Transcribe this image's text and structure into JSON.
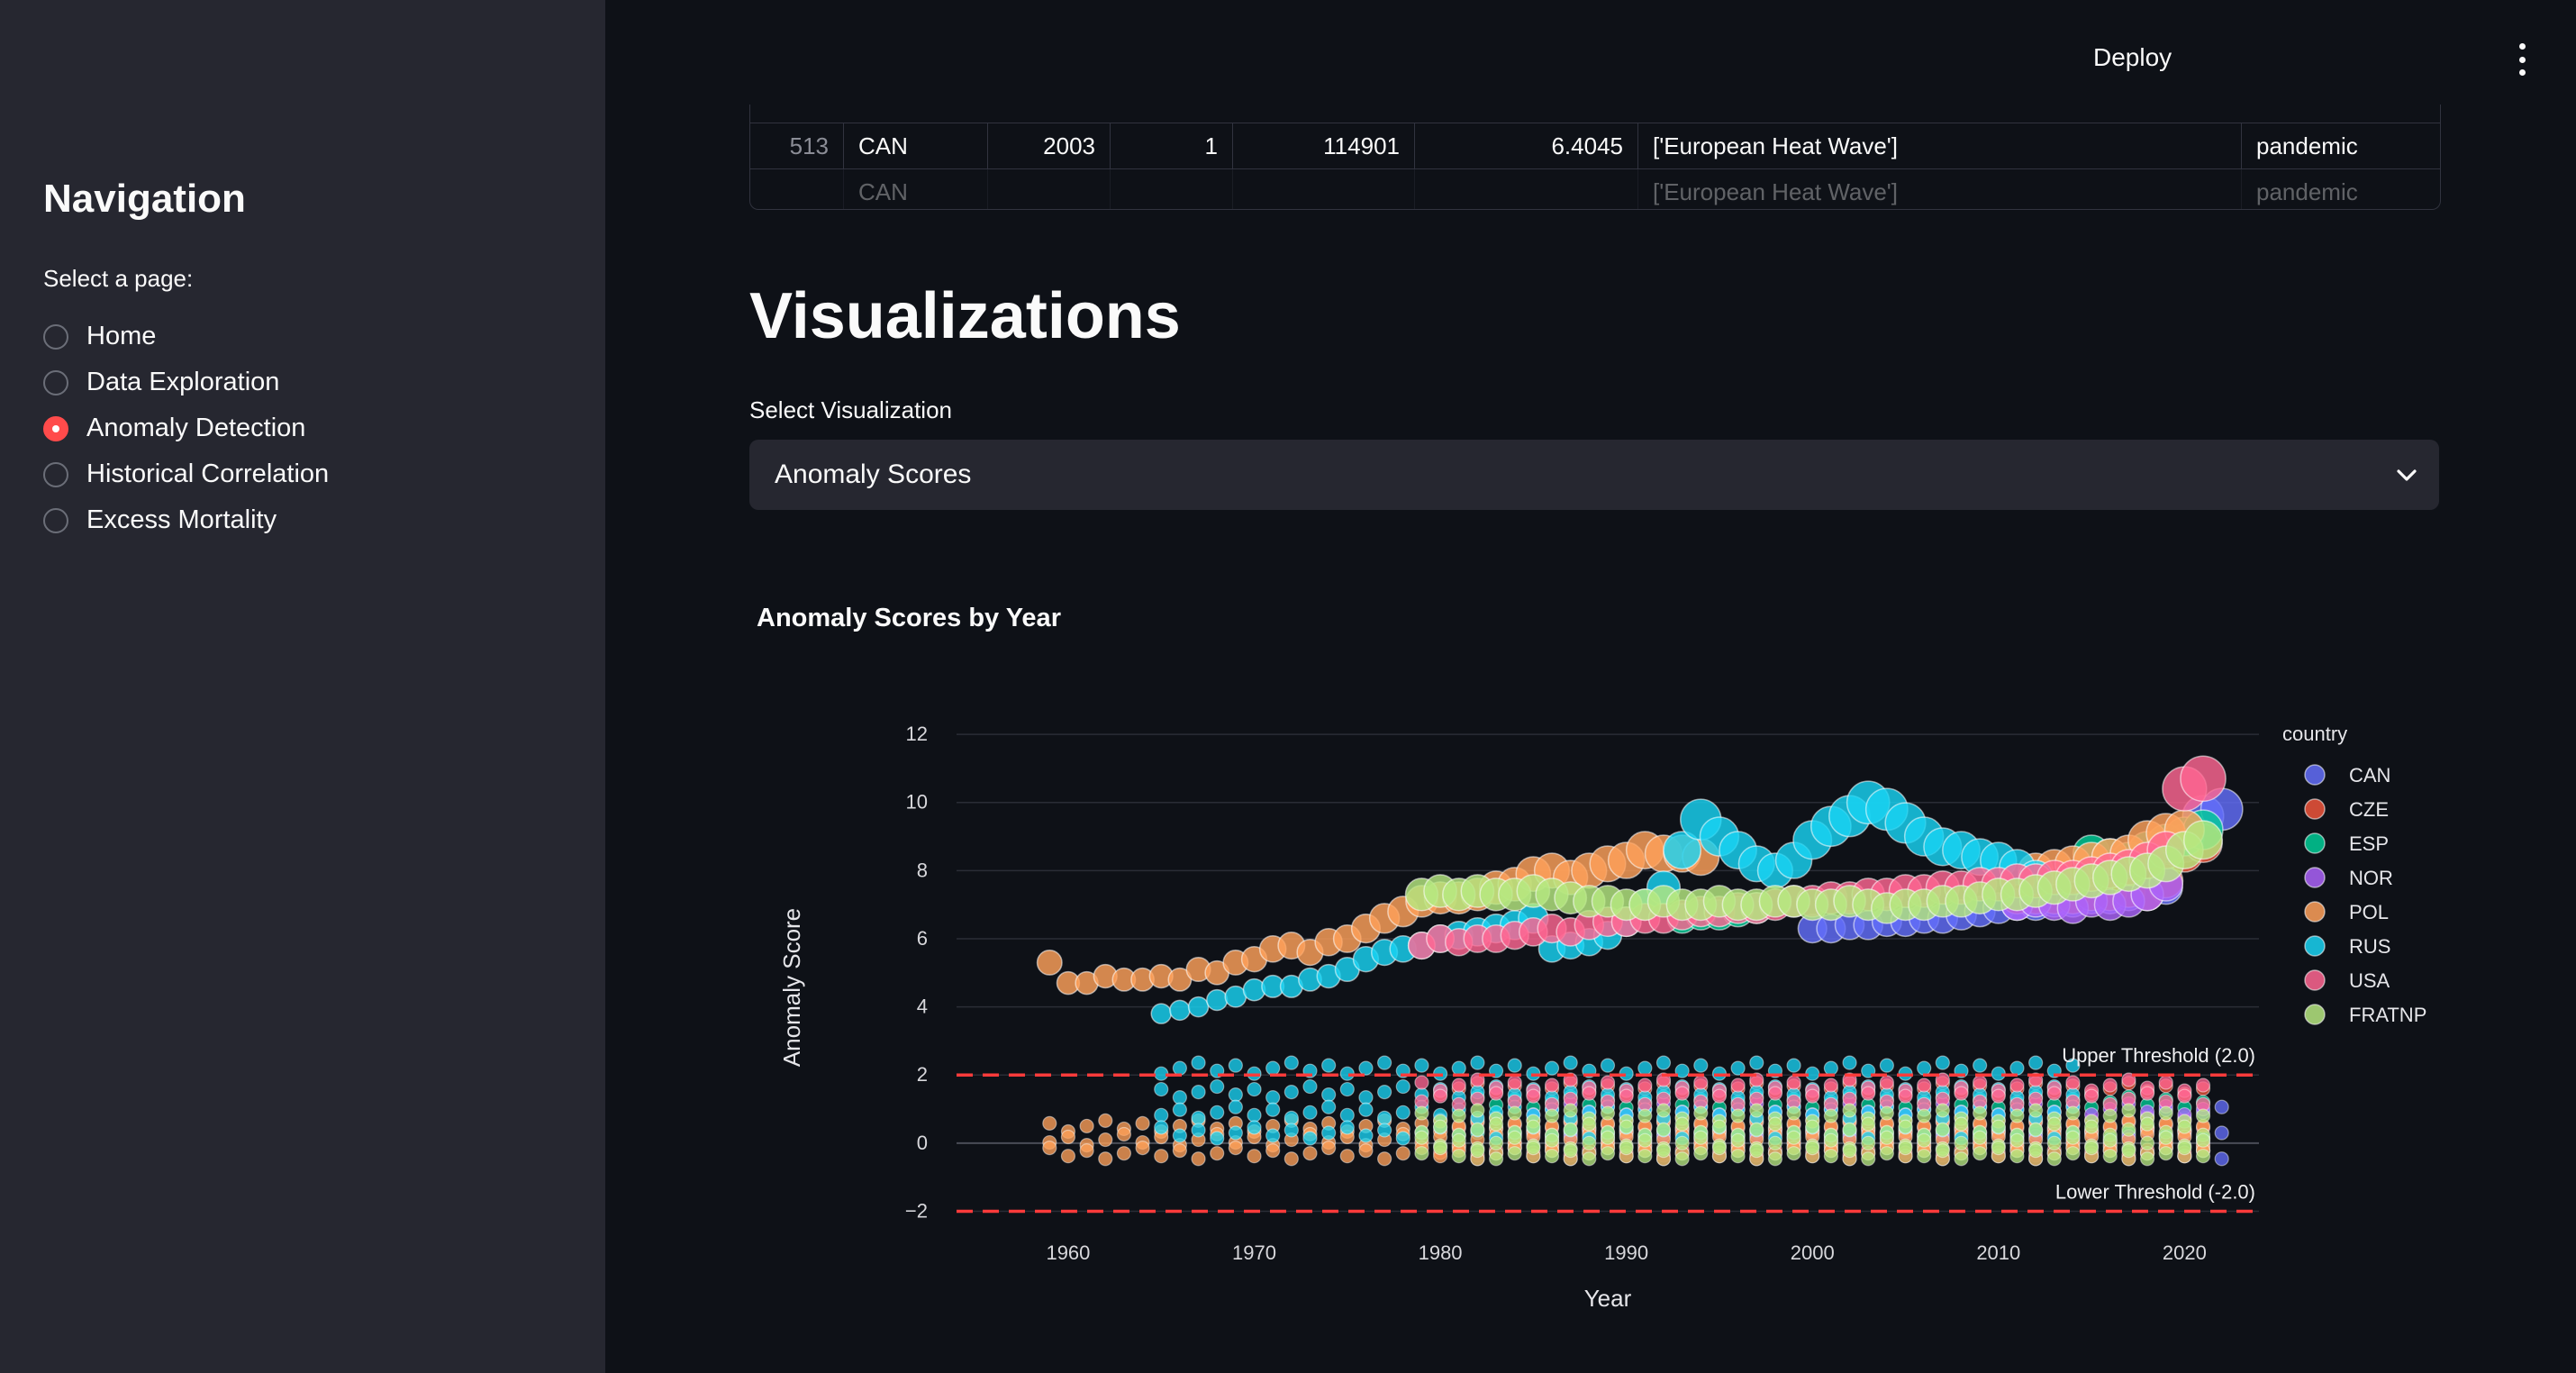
{
  "sidebar": {
    "title": "Navigation",
    "prompt": "Select a page:",
    "items": [
      {
        "label": "Home",
        "selected": false
      },
      {
        "label": "Data Exploration",
        "selected": false
      },
      {
        "label": "Anomaly Detection",
        "selected": true
      },
      {
        "label": "Historical Correlation",
        "selected": false
      },
      {
        "label": "Excess Mortality",
        "selected": false
      }
    ]
  },
  "header": {
    "deploy_label": "Deploy",
    "menu_icon": "kebab-menu-icon"
  },
  "table": {
    "visible_row": [
      "513",
      "CAN",
      "2003",
      "1",
      "114901",
      "6.4045",
      "['European Heat Wave']",
      "pandemic"
    ],
    "partial_row": [
      "",
      "CAN",
      "",
      "",
      "",
      "",
      "['European Heat Wave']",
      "pandemic"
    ]
  },
  "section": {
    "title": "Visualizations"
  },
  "select": {
    "label": "Select Visualization",
    "value": "Anomaly Scores",
    "icon": "chevron-down-icon"
  },
  "colors": {
    "accent": "#ff4b4b",
    "sidebar_bg": "#262730",
    "main_bg": "#0e1117"
  },
  "chart_data": {
    "type": "scatter",
    "title": "Anomaly Scores by Year",
    "xlabel": "Year",
    "ylabel": "Anomaly Score",
    "xlim": [
      1954,
      2024
    ],
    "ylim": [
      -2.2,
      12.4
    ],
    "x_ticks": [
      1960,
      1970,
      1980,
      1990,
      2000,
      2010,
      2020
    ],
    "y_ticks": [
      -2,
      0,
      2,
      4,
      6,
      8,
      10,
      12
    ],
    "grid": true,
    "legend_title": "country",
    "legend_position": "right",
    "thresholds": [
      {
        "label": "Upper Threshold (2.0)",
        "value": 2.0
      },
      {
        "label": "Lower Threshold (-2.0)",
        "value": -2.0
      }
    ],
    "series": [
      {
        "name": "CAN",
        "color": "#636efa",
        "high_points": [
          [
            2000,
            6.3
          ],
          [
            2001,
            6.3
          ],
          [
            2002,
            6.4
          ],
          [
            2003,
            6.4
          ],
          [
            2004,
            6.5
          ],
          [
            2005,
            6.5
          ],
          [
            2006,
            6.6
          ],
          [
            2007,
            6.6
          ],
          [
            2008,
            6.7
          ],
          [
            2009,
            6.8
          ],
          [
            2010,
            6.9
          ],
          [
            2011,
            7.0
          ],
          [
            2012,
            7.0
          ],
          [
            2013,
            7.1
          ],
          [
            2014,
            7.1
          ],
          [
            2015,
            7.2
          ],
          [
            2016,
            7.2
          ],
          [
            2017,
            7.3
          ],
          [
            2018,
            7.3
          ],
          [
            2019,
            7.5
          ],
          [
            2020,
            8.8
          ],
          [
            2021,
            9.6
          ],
          [
            2022,
            9.8
          ]
        ],
        "low_years": [
          2018,
          2022
        ],
        "low_values": [
          0.9,
          0.3,
          -0.3
        ]
      },
      {
        "name": "CZE",
        "color": "#ef553b",
        "high_points": [
          [
            2011,
            7.2
          ],
          [
            2012,
            7.2
          ],
          [
            2013,
            7.2
          ],
          [
            2014,
            7.2
          ],
          [
            2015,
            7.3
          ],
          [
            2016,
            7.3
          ],
          [
            2017,
            7.4
          ],
          [
            2018,
            7.3
          ],
          [
            2019,
            7.7
          ],
          [
            2020,
            8.5
          ],
          [
            2021,
            8.8
          ]
        ],
        "low_years": [
          1980,
          2021
        ],
        "low_values": [
          1.6,
          0.6,
          -0.2
        ]
      },
      {
        "name": "ESP",
        "color": "#00cc96",
        "high_points": [
          [
            1993,
            6.6
          ],
          [
            1994,
            6.7
          ],
          [
            1995,
            6.7
          ],
          [
            1996,
            6.8
          ],
          [
            1997,
            6.9
          ],
          [
            2015,
            8.5
          ],
          [
            2016,
            8.4
          ],
          [
            2017,
            8.3
          ],
          [
            2018,
            8.6
          ],
          [
            2019,
            8.8
          ],
          [
            2020,
            9.0
          ],
          [
            2021,
            9.2
          ]
        ],
        "low_years": [
          1982,
          2021
        ],
        "low_values": [
          1.2,
          0.3,
          -0.3
        ]
      },
      {
        "name": "NOR",
        "color": "#ab63fa",
        "high_points": [
          [
            2011,
            7.0
          ],
          [
            2012,
            7.1
          ],
          [
            2013,
            7.0
          ],
          [
            2014,
            6.9
          ],
          [
            2015,
            7.1
          ],
          [
            2016,
            7.0
          ],
          [
            2017,
            7.1
          ],
          [
            2018,
            7.3
          ],
          [
            2019,
            7.6
          ]
        ],
        "low_years": [
          1985,
          2021
        ],
        "low_values": [
          1.0,
          0.2
        ]
      },
      {
        "name": "POL",
        "color": "#ffa15a",
        "high_points": [
          [
            1959,
            5.3
          ],
          [
            1960,
            4.7
          ],
          [
            1961,
            4.7
          ],
          [
            1962,
            4.9
          ],
          [
            1963,
            4.8
          ],
          [
            1964,
            4.8
          ],
          [
            1965,
            4.9
          ],
          [
            1966,
            4.8
          ],
          [
            1967,
            5.1
          ],
          [
            1968,
            5.0
          ],
          [
            1969,
            5.3
          ],
          [
            1970,
            5.4
          ],
          [
            1971,
            5.7
          ],
          [
            1972,
            5.8
          ],
          [
            1973,
            5.6
          ],
          [
            1974,
            5.9
          ],
          [
            1975,
            6.0
          ],
          [
            1976,
            6.3
          ],
          [
            1977,
            6.6
          ],
          [
            1978,
            6.8
          ],
          [
            1979,
            7.1
          ],
          [
            1980,
            7.2
          ],
          [
            1981,
            7.2
          ],
          [
            1982,
            7.3
          ],
          [
            1983,
            7.5
          ],
          [
            1984,
            7.6
          ],
          [
            1985,
            7.9
          ],
          [
            1986,
            8.0
          ],
          [
            1987,
            7.8
          ],
          [
            1988,
            8.0
          ],
          [
            1989,
            8.2
          ],
          [
            1990,
            8.3
          ],
          [
            1991,
            8.6
          ],
          [
            1992,
            8.5
          ],
          [
            1993,
            8.5
          ],
          [
            1994,
            8.4
          ],
          [
            2012,
            8.0
          ],
          [
            2013,
            8.1
          ],
          [
            2014,
            8.2
          ],
          [
            2015,
            8.3
          ],
          [
            2016,
            8.4
          ],
          [
            2017,
            8.5
          ],
          [
            2018,
            8.9
          ],
          [
            2019,
            9.1
          ],
          [
            2020,
            9.2
          ]
        ],
        "low_years": [
          1959,
          2021
        ],
        "low_values": [
          0.5,
          0.1,
          -0.3
        ]
      },
      {
        "name": "RUS",
        "color": "#19d3f3",
        "high_points": [
          [
            1965,
            3.8
          ],
          [
            1966,
            3.9
          ],
          [
            1967,
            4.0
          ],
          [
            1968,
            4.2
          ],
          [
            1969,
            4.3
          ],
          [
            1970,
            4.5
          ],
          [
            1971,
            4.6
          ],
          [
            1972,
            4.6
          ],
          [
            1973,
            4.8
          ],
          [
            1974,
            4.9
          ],
          [
            1975,
            5.1
          ],
          [
            1976,
            5.4
          ],
          [
            1977,
            5.6
          ],
          [
            1978,
            5.7
          ],
          [
            1979,
            5.8
          ],
          [
            1980,
            6.0
          ],
          [
            1981,
            6.1
          ],
          [
            1982,
            6.2
          ],
          [
            1983,
            6.3
          ],
          [
            1984,
            6.4
          ],
          [
            1985,
            6.6
          ],
          [
            1986,
            5.7
          ],
          [
            1987,
            5.8
          ],
          [
            1988,
            5.9
          ],
          [
            1989,
            6.1
          ],
          [
            1990,
            6.5
          ],
          [
            1991,
            7.0
          ],
          [
            1992,
            7.5
          ],
          [
            1993,
            8.6
          ],
          [
            1994,
            9.5
          ],
          [
            1995,
            9.0
          ],
          [
            1996,
            8.6
          ],
          [
            1997,
            8.2
          ],
          [
            1998,
            8.0
          ],
          [
            1999,
            8.3
          ],
          [
            2000,
            8.9
          ],
          [
            2001,
            9.3
          ],
          [
            2002,
            9.6
          ],
          [
            2003,
            10.0
          ],
          [
            2004,
            9.8
          ],
          [
            2005,
            9.4
          ],
          [
            2006,
            9.0
          ],
          [
            2007,
            8.7
          ],
          [
            2008,
            8.6
          ],
          [
            2009,
            8.4
          ],
          [
            2010,
            8.3
          ],
          [
            2011,
            8.1
          ],
          [
            2012,
            7.8
          ]
        ],
        "low_years": [
          1965,
          2014
        ],
        "low_values": [
          2.2,
          1.5,
          0.9,
          0.3
        ]
      },
      {
        "name": "USA",
        "color": "#ff6692",
        "high_points": [
          [
            1979,
            5.8
          ],
          [
            1980,
            6.0
          ],
          [
            1981,
            5.9
          ],
          [
            1982,
            6.0
          ],
          [
            1983,
            6.0
          ],
          [
            1984,
            6.1
          ],
          [
            1985,
            6.2
          ],
          [
            1986,
            6.3
          ],
          [
            1987,
            6.2
          ],
          [
            1988,
            6.4
          ],
          [
            1989,
            6.5
          ],
          [
            1990,
            6.5
          ],
          [
            1991,
            6.6
          ],
          [
            1992,
            6.6
          ],
          [
            1993,
            6.7
          ],
          [
            1994,
            6.8
          ],
          [
            1995,
            6.8
          ],
          [
            1996,
            6.9
          ],
          [
            1997,
            6.9
          ],
          [
            1998,
            7.0
          ],
          [
            1999,
            7.1
          ],
          [
            2000,
            7.1
          ],
          [
            2001,
            7.2
          ],
          [
            2002,
            7.2
          ],
          [
            2003,
            7.3
          ],
          [
            2004,
            7.3
          ],
          [
            2005,
            7.4
          ],
          [
            2006,
            7.4
          ],
          [
            2007,
            7.5
          ],
          [
            2008,
            7.5
          ],
          [
            2009,
            7.6
          ],
          [
            2010,
            7.6
          ],
          [
            2011,
            7.7
          ],
          [
            2012,
            7.7
          ],
          [
            2013,
            7.8
          ],
          [
            2014,
            7.8
          ],
          [
            2015,
            7.9
          ],
          [
            2016,
            8.0
          ],
          [
            2017,
            8.1
          ],
          [
            2018,
            8.3
          ],
          [
            2019,
            8.6
          ],
          [
            2020,
            10.4
          ],
          [
            2021,
            10.7
          ]
        ],
        "low_years": [
          1979,
          2021
        ],
        "low_values": [
          1.7,
          1.3
        ]
      },
      {
        "name": "FRATNP",
        "color": "#b6e880",
        "high_points": [
          [
            1979,
            7.3
          ],
          [
            1980,
            7.4
          ],
          [
            1981,
            7.3
          ],
          [
            1982,
            7.4
          ],
          [
            1983,
            7.3
          ],
          [
            1984,
            7.3
          ],
          [
            1985,
            7.4
          ],
          [
            1986,
            7.3
          ],
          [
            1987,
            7.2
          ],
          [
            1988,
            7.1
          ],
          [
            1989,
            7.1
          ],
          [
            1990,
            7.0
          ],
          [
            1991,
            7.0
          ],
          [
            1992,
            7.1
          ],
          [
            1993,
            7.0
          ],
          [
            1994,
            7.0
          ],
          [
            1995,
            7.1
          ],
          [
            1996,
            7.0
          ],
          [
            1997,
            7.0
          ],
          [
            1998,
            7.1
          ],
          [
            1999,
            7.1
          ],
          [
            2000,
            7.0
          ],
          [
            2001,
            7.0
          ],
          [
            2002,
            7.1
          ],
          [
            2003,
            7.0
          ],
          [
            2004,
            6.9
          ],
          [
            2005,
            7.0
          ],
          [
            2006,
            7.0
          ],
          [
            2007,
            7.1
          ],
          [
            2008,
            7.1
          ],
          [
            2009,
            7.2
          ],
          [
            2010,
            7.3
          ],
          [
            2011,
            7.3
          ],
          [
            2012,
            7.4
          ],
          [
            2013,
            7.5
          ],
          [
            2014,
            7.6
          ],
          [
            2015,
            7.7
          ],
          [
            2016,
            7.8
          ],
          [
            2017,
            7.9
          ],
          [
            2018,
            8.0
          ],
          [
            2019,
            8.2
          ],
          [
            2020,
            8.6
          ],
          [
            2021,
            8.9
          ]
        ],
        "low_years": [
          1979,
          2021
        ],
        "low_values": [
          0.8,
          0.4,
          0.0,
          -0.3
        ]
      }
    ]
  }
}
